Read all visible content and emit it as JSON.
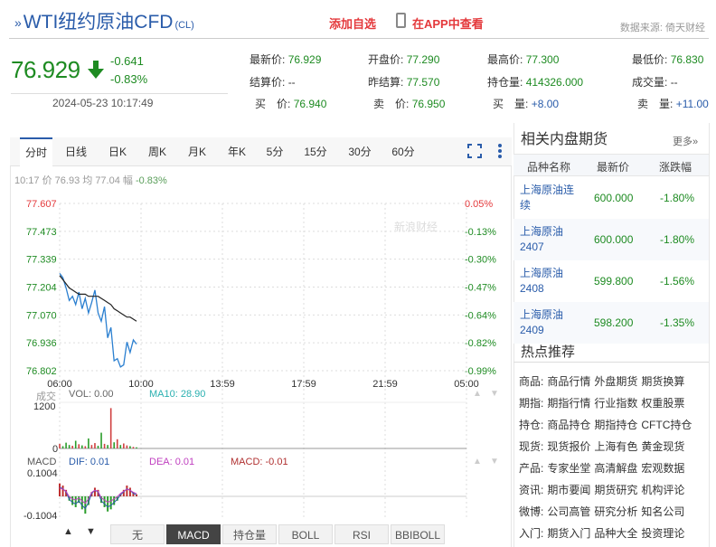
{
  "header": {
    "title": "WTI纽约原油CFD",
    "code": "(CL)",
    "add_fav": "添加自选",
    "app_link": "在APP中查看",
    "source": "数据来源: 倚天财经"
  },
  "quote": {
    "price": "76.929",
    "change": "-0.641",
    "change_pct": "-0.83%",
    "timestamp": "2024-05-23 10:17:49",
    "colors": {
      "down": "#1e8b22",
      "up": "#e4393c",
      "link": "#2a5caa"
    }
  },
  "stats": {
    "latest_label": "最新价:",
    "latest": "76.929",
    "open_label": "开盘价:",
    "open": "77.290",
    "high_label": "最高价:",
    "high": "77.300",
    "low_label": "最低价:",
    "low": "76.830",
    "settle_label": "结算价:",
    "settle": "--",
    "prev_settle_label": "昨结算:",
    "prev_settle": "77.570",
    "oi_label": "持仓量:",
    "oi": "414326.000",
    "volume_label": "成交量:",
    "volume": "--",
    "bid_label": "买　价:",
    "bid": "76.940",
    "ask_label": "卖　价:",
    "ask": "76.950",
    "bid_vol_label": "买　量:",
    "bid_vol": "+8.00",
    "ask_vol_label": "卖　量:",
    "ask_vol": "+11.00"
  },
  "chart": {
    "tabs": [
      "分时",
      "日线",
      "日K",
      "周K",
      "月K",
      "年K",
      "5分",
      "15分",
      "30分",
      "60分"
    ],
    "active_tab": "分时",
    "info": {
      "time": "10:17",
      "price_label": "价",
      "price": "76.93",
      "avg_label": "均",
      "avg": "77.04",
      "range_label": "幅",
      "range": "-0.83%"
    },
    "vol_label": "成交",
    "vol_text": "VOL: 0.00",
    "ma_text": "MA10: 28.90",
    "vol_max": "1200",
    "vol_zero": "0",
    "macd_label": "MACD",
    "dif_text": "DIF: 0.01",
    "dea_text": "DEA: 0.01",
    "macd_text": "MACD: -0.01",
    "macd_hi": "0.1004",
    "macd_lo": "-0.1004",
    "bottom_tabs": [
      "无",
      "MACD",
      "持仓量",
      "BOLL",
      "RSI",
      "BBIBOLL"
    ],
    "bottom_active": "MACD",
    "watermark": "新浪财经",
    "up_arrow": "▲",
    "down_arrow": "▼"
  },
  "chart_data": {
    "type": "line",
    "x_ticks": [
      "06:00",
      "10:00",
      "13:59",
      "17:59",
      "21:59",
      "05:00"
    ],
    "y_ticks": [
      "77.607",
      "77.473",
      "77.339",
      "77.204",
      "77.070",
      "76.936",
      "76.802"
    ],
    "y_pct_ticks": [
      "0.05%",
      "-0.13%",
      "-0.30%",
      "-0.47%",
      "-0.64%",
      "-0.82%",
      "-0.99%"
    ],
    "ylim": [
      76.802,
      77.607
    ],
    "price": [
      77.27,
      77.25,
      77.2,
      77.14,
      77.16,
      77.12,
      77.18,
      77.1,
      77.15,
      77.08,
      77.13,
      77.19,
      77.08,
      77.04,
      77.11,
      76.96,
      77.01,
      76.85,
      76.86,
      76.82,
      76.83,
      76.94,
      76.89,
      76.95,
      76.93
    ],
    "avg": [
      77.26,
      77.24,
      77.22,
      77.2,
      77.19,
      77.18,
      77.17,
      77.17,
      77.17,
      77.16,
      77.16,
      77.16,
      77.16,
      77.15,
      77.14,
      77.13,
      77.12,
      77.1,
      77.09,
      77.08,
      77.07,
      77.06,
      77.06,
      77.05,
      77.04
    ],
    "volume": [
      120,
      60,
      150,
      90,
      70,
      200,
      110,
      80,
      60,
      260,
      90,
      140,
      70,
      410,
      120,
      90,
      1050,
      160,
      240,
      90,
      130,
      80,
      60,
      40,
      30
    ],
    "macd": [
      0.06,
      0.05,
      0.03,
      -0.02,
      -0.04,
      -0.05,
      -0.03,
      -0.06,
      -0.08,
      -0.04,
      0.02,
      0.04,
      0.03,
      -0.03,
      -0.05,
      -0.07,
      -0.06,
      -0.04,
      -0.02,
      0.01,
      0.03,
      0.05,
      0.04,
      0.02,
      0.01
    ]
  },
  "sidebar": {
    "title": "相关内盘期货",
    "more": "更多»",
    "headers": [
      "品种名称",
      "最新价",
      "涨跌幅"
    ],
    "rows": [
      {
        "name1": "上海原油连",
        "name2": "续",
        "price": "600.000",
        "pct": "-1.80%"
      },
      {
        "name1": "上海原油",
        "name2": "2407",
        "price": "600.000",
        "pct": "-1.80%"
      },
      {
        "name1": "上海原油",
        "name2": "2408",
        "price": "599.800",
        "pct": "-1.56%"
      },
      {
        "name1": "上海原油",
        "name2": "2409",
        "price": "598.200",
        "pct": "-1.35%"
      }
    ],
    "hot_title": "热点推荐",
    "hot": [
      {
        "label": "商品:",
        "links": [
          "商品行情",
          "外盘期货",
          "期货换算"
        ]
      },
      {
        "label": "期指:",
        "links": [
          "期指行情",
          "行业指数",
          "权重股票"
        ]
      },
      {
        "label": "持仓:",
        "links": [
          "商品持仓",
          "期指持仓",
          "CFTC持仓"
        ]
      },
      {
        "label": "现货:",
        "links": [
          "现货报价",
          "上海有色",
          "黄金现货"
        ]
      },
      {
        "label": "产品:",
        "links": [
          "专家坐堂",
          "高清解盘",
          "宏观数据"
        ]
      },
      {
        "label": "资讯:",
        "links": [
          "期市要闻",
          "期货研究",
          "机构评论"
        ]
      },
      {
        "label": "微博:",
        "links": [
          "公司高管",
          "研究分析",
          "知名公司"
        ]
      },
      {
        "label": "入门:",
        "links": [
          "期货入门",
          "品种大全",
          "投资理论"
        ]
      }
    ]
  }
}
